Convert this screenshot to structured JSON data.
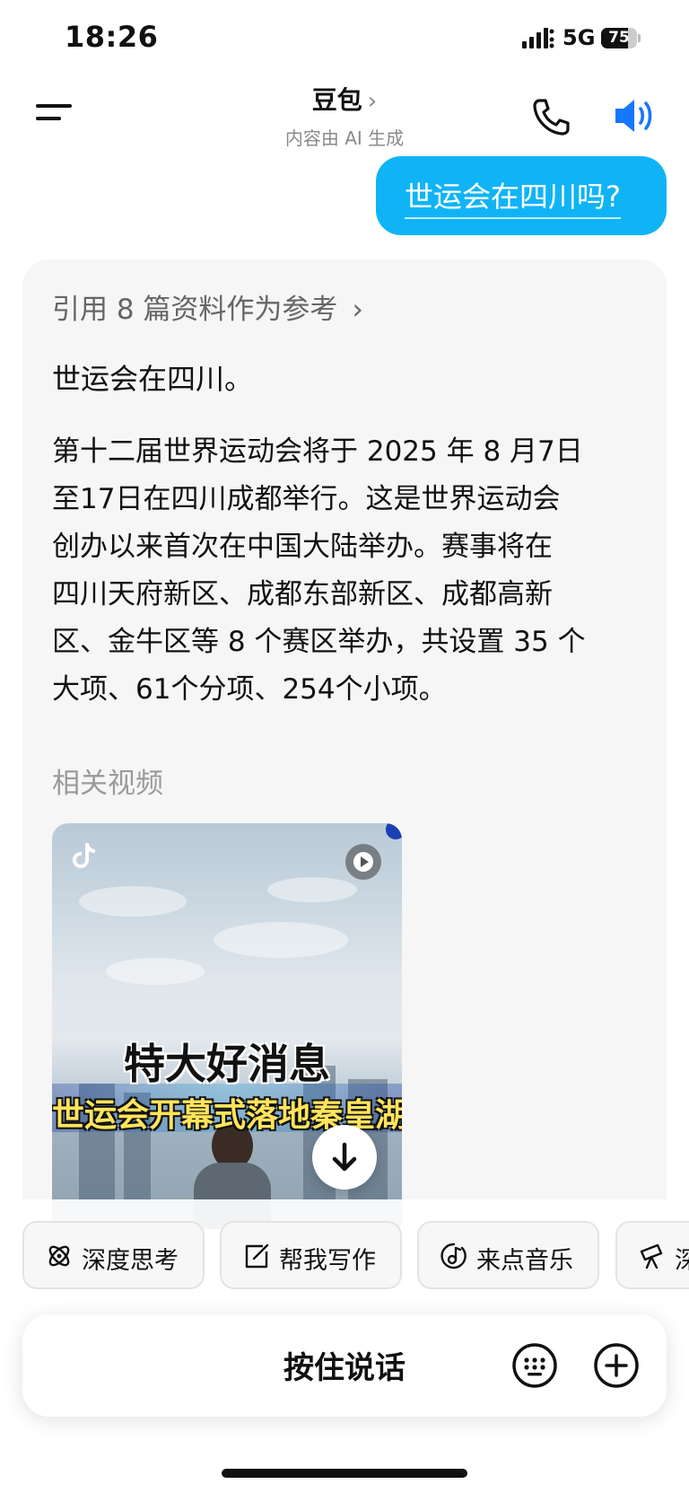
{
  "status_bar": {
    "time": "18:26",
    "network": "5G",
    "battery_level": 75,
    "battery_label": "75"
  },
  "header": {
    "title": "豆包",
    "chevron": "›",
    "subtitle": "内容由 AI 生成",
    "icons": [
      "menu-icon",
      "phone-icon",
      "speaker-icon"
    ]
  },
  "user_message": {
    "text": "世运会在四川吗?"
  },
  "assistant": {
    "references": "引用 8 篇资料作为参考",
    "references_chevron": "›",
    "lead": "世运会在四川。",
    "body_lines": [
      "第十二届世界运动会将于 2025 年 8 月7日",
      "至17日在四川成都举行。这是世界运动会",
      "创办以来首次在中国大陆举办。赛事将在",
      "四川天府新区、成都东部新区、成都高新",
      "区、金牛区等 8 个赛区举办，共设置 35 个",
      "大项、61个分项、254个小项。"
    ],
    "related_videos_label": "相关视频",
    "video": {
      "headline": "特大好消息",
      "subheadline": "世运会开幕式落地秦皇湖"
    }
  },
  "quick_actions": [
    {
      "label": "深度思考",
      "icon": "atom-icon"
    },
    {
      "label": "帮我写作",
      "icon": "edit-icon"
    },
    {
      "label": "来点音乐",
      "icon": "music-icon"
    },
    {
      "label": "深",
      "icon": "telescope-icon"
    }
  ],
  "input_bar": {
    "hold_to_talk": "按住说话",
    "icons": [
      "keyboard-icon",
      "plus-icon"
    ]
  },
  "colors": {
    "accent": "#10b4f6",
    "speaker": "#1677ff",
    "card_bg": "#f6f6f6",
    "muted_text": "#9a9a9a"
  }
}
